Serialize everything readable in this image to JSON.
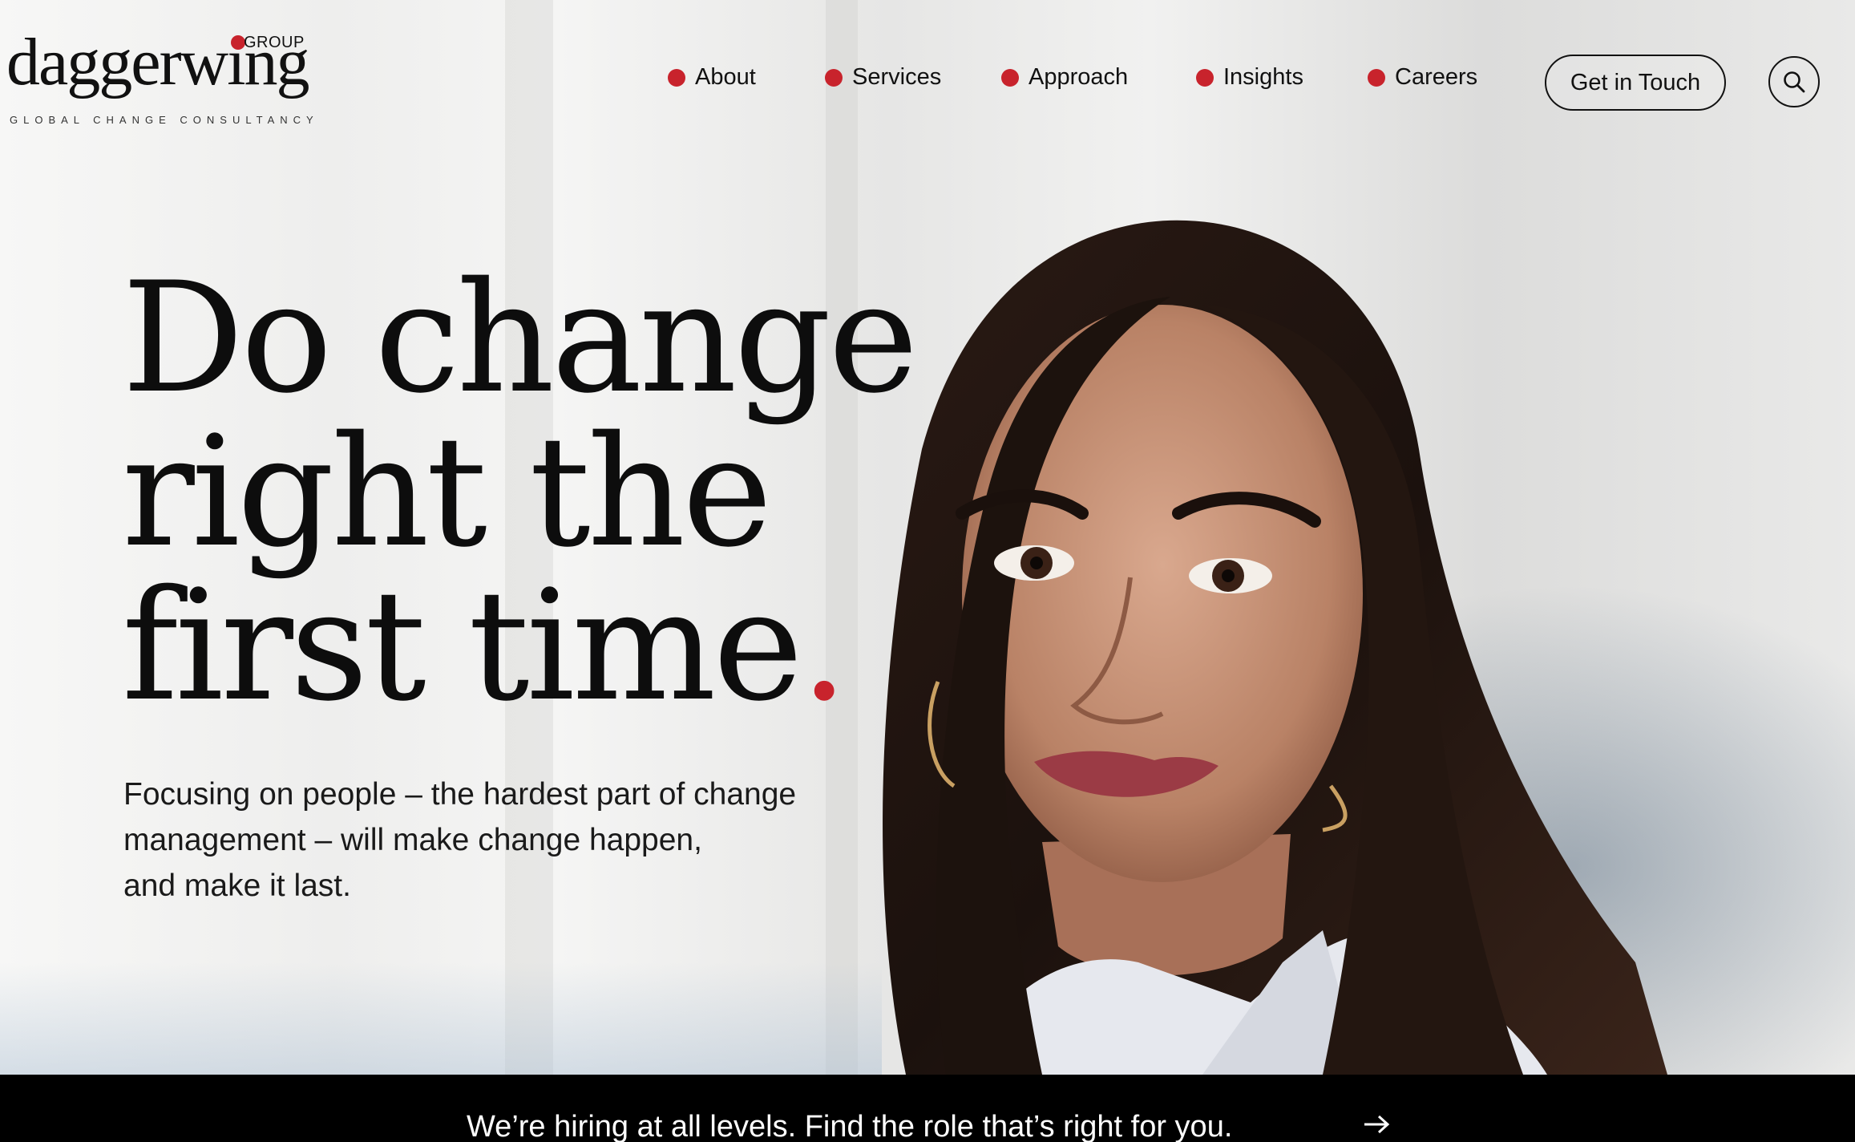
{
  "brand": {
    "name": "daggerwing",
    "group_label": "GROUP",
    "tagline": "GLOBAL CHANGE CONSULTANCY",
    "accent_color": "#c8232c"
  },
  "nav": {
    "items": [
      {
        "label": "About"
      },
      {
        "label": "Services"
      },
      {
        "label": "Approach"
      },
      {
        "label": "Insights"
      },
      {
        "label": "Careers"
      }
    ],
    "cta_label": "Get in Touch",
    "search_icon": "search-icon"
  },
  "hero": {
    "headline_lines": [
      "Do change",
      "right the",
      "first time"
    ],
    "headline_period": ".",
    "lead_lines": [
      "Focusing on people – the hardest part of change",
      "management – will make change happen,",
      "and make it last."
    ]
  },
  "banner": {
    "text": "We’re hiring at all levels. Find the role that’s right for you.",
    "arrow_icon": "arrow-right-icon"
  }
}
